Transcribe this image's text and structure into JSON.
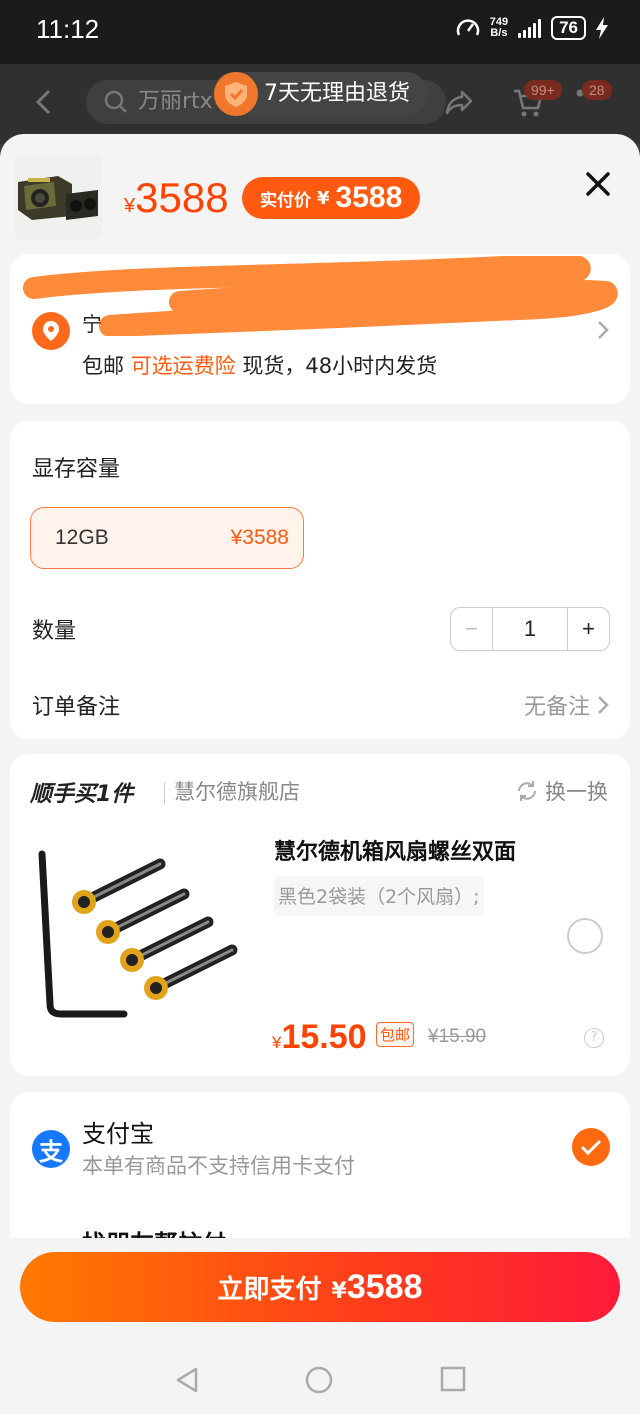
{
  "status_bar": {
    "time": "11:12",
    "speed_value": "749",
    "speed_unit": "B/s",
    "battery": "76"
  },
  "header": {
    "search_text": "万丽rtx",
    "promo": "7天无理由退货",
    "cart_badge": "99+",
    "msg_badge": "28"
  },
  "product": {
    "currency": "¥",
    "price": "3588",
    "pay_label": "实付价",
    "pay_price": "3588"
  },
  "shipping": {
    "free": "包邮",
    "insurance": "可选运费险",
    "stock": "现货，48小时内发货",
    "addr_hint": "宁"
  },
  "spec": {
    "title": "显存容量",
    "option_name": "12GB",
    "option_price": "¥3588",
    "quantity_label": "数量",
    "quantity": "1",
    "minus": "−",
    "plus": "+",
    "note_label": "订单备注",
    "note_value": "无备注"
  },
  "addon": {
    "heading": "顺手买1件",
    "store": "慧尔德旗舰店",
    "swap": "换一换",
    "title": "慧尔德机箱风扇螺丝双面",
    "variant": "黑色2袋装（2个风扇）;",
    "currency": "¥",
    "price": "15.50",
    "free_tag": "包邮",
    "orig_price": "¥15.90",
    "help": "?"
  },
  "payment": {
    "icon_glyph": "支",
    "method": "支付宝",
    "note": "本单有商品不支持信用卡支付",
    "alt_method": "找朋友帮忙付"
  },
  "pay_button": {
    "label": "立即支付",
    "currency": "¥",
    "amount": "3588"
  },
  "colors": {
    "accent": "#ff5a10",
    "price": "#ff4400",
    "alipay": "#1677ff"
  }
}
